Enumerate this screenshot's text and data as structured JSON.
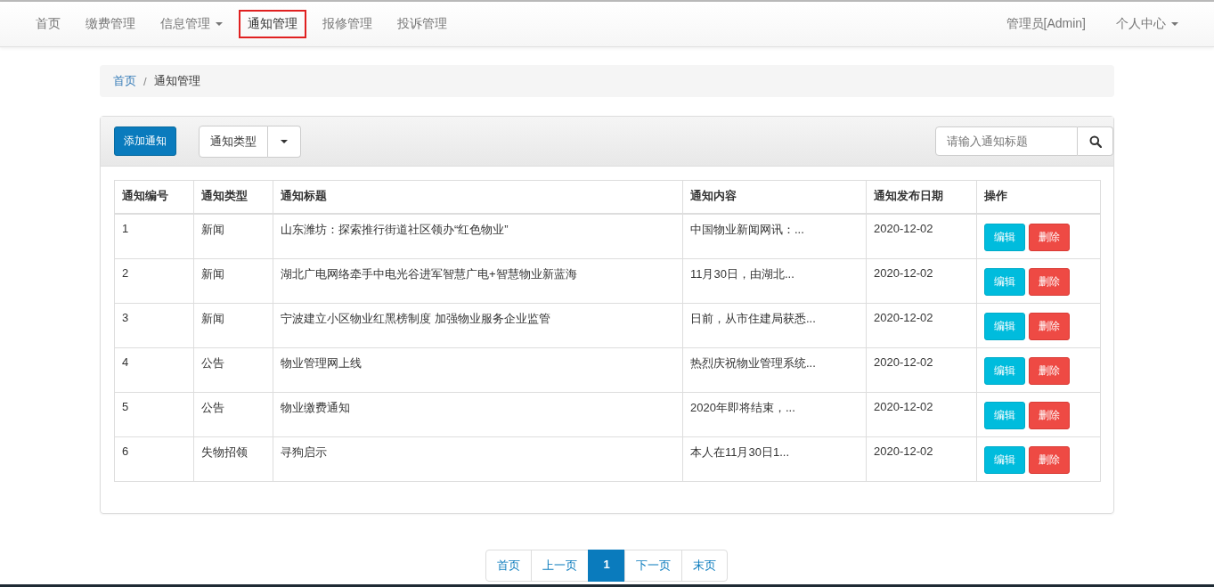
{
  "navbar": {
    "items": [
      {
        "label": "首页",
        "selected": false,
        "dropdown": false
      },
      {
        "label": "缴费管理",
        "selected": false,
        "dropdown": false
      },
      {
        "label": "信息管理",
        "selected": false,
        "dropdown": true
      },
      {
        "label": "通知管理",
        "selected": true,
        "dropdown": false
      },
      {
        "label": "报修管理",
        "selected": false,
        "dropdown": false
      },
      {
        "label": "投诉管理",
        "selected": false,
        "dropdown": false
      }
    ],
    "right_items": [
      {
        "label": "管理员[Admin]",
        "dropdown": false
      },
      {
        "label": "个人中心",
        "dropdown": true
      }
    ]
  },
  "breadcrumb": [
    "首页",
    "通知管理"
  ],
  "breadcrumb_separator": "/",
  "toolbar": {
    "add_button": "添加通知",
    "type_dropdown": "通知类型",
    "search": {
      "placeholder": "请输入通知标题"
    }
  },
  "table": {
    "columns": [
      "通知编号",
      "通知类型",
      "通知标题",
      "通知内容",
      "通知发布日期",
      "操作"
    ],
    "rows": [
      {
        "id": "1",
        "type": "新闻",
        "title": "山东潍坊：探索推行街道社区领办“红色物业”",
        "content": "中国物业新闻网讯：...",
        "date": "2020-12-02",
        "actions": [
          "编辑",
          "删除"
        ]
      },
      {
        "id": "2",
        "type": "新闻",
        "title": "湖北广电网络牵手中电光谷进军智慧广电+智慧物业新蓝海",
        "content": "11月30日，由湖北...",
        "date": "2020-12-02",
        "actions": [
          "编辑",
          "删除"
        ]
      },
      {
        "id": "3",
        "type": "新闻",
        "title": "宁波建立小区物业红黑榜制度 加强物业服务企业监管",
        "content": "日前，从市住建局获悉...",
        "date": "2020-12-02",
        "actions": [
          "编辑",
          "删除"
        ]
      },
      {
        "id": "4",
        "type": "公告",
        "title": "物业管理网上线",
        "content": "热烈庆祝物业管理系统...",
        "date": "2020-12-02",
        "actions": [
          "编辑",
          "删除"
        ]
      },
      {
        "id": "5",
        "type": "公告",
        "title": "物业缴费通知",
        "content": "2020年即将结束，...",
        "date": "2020-12-02",
        "actions": [
          "编辑",
          "删除"
        ]
      },
      {
        "id": "6",
        "type": "失物招领",
        "title": "寻狗启示",
        "content": "本人在11月30日1...",
        "date": "2020-12-02",
        "actions": [
          "编辑",
          "删除"
        ]
      }
    ]
  },
  "pagination": [
    {
      "label": "首页",
      "selected": false
    },
    {
      "label": "上一页",
      "selected": false
    },
    {
      "label": "1",
      "selected": true
    },
    {
      "label": "下一页",
      "selected": false
    },
    {
      "label": "末页",
      "selected": false
    }
  ]
}
